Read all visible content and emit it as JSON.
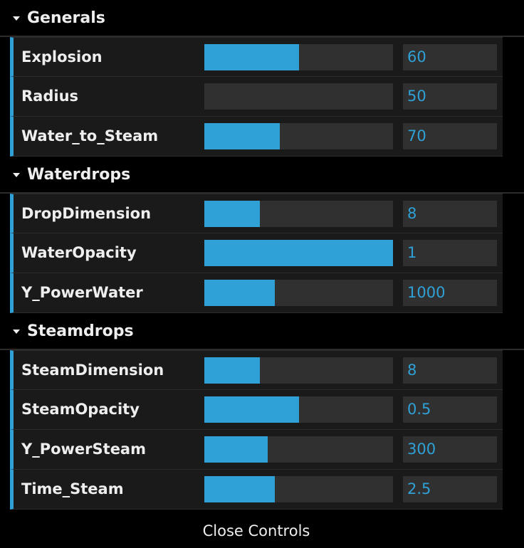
{
  "folders": [
    {
      "title": "Generals",
      "controls": [
        {
          "label": "Explosion",
          "value": "60",
          "fill_fraction": 0.5
        },
        {
          "label": "Radius",
          "value": "50",
          "fill_fraction": 0.0
        },
        {
          "label": "Water_to_Steam",
          "value": "70",
          "fill_fraction": 0.4
        }
      ]
    },
    {
      "title": "Waterdrops",
      "controls": [
        {
          "label": "DropDimension",
          "value": "8",
          "fill_fraction": 0.295
        },
        {
          "label": "WaterOpacity",
          "value": "1",
          "fill_fraction": 1.0
        },
        {
          "label": "Y_PowerWater",
          "value": "1000",
          "fill_fraction": 0.375
        }
      ]
    },
    {
      "title": "Steamdrops",
      "controls": [
        {
          "label": "SteamDimension",
          "value": "8",
          "fill_fraction": 0.295
        },
        {
          "label": "SteamOpacity",
          "value": "0.5",
          "fill_fraction": 0.5
        },
        {
          "label": "Y_PowerSteam",
          "value": "300",
          "fill_fraction": 0.335
        },
        {
          "label": "Time_Steam",
          "value": "2.5",
          "fill_fraction": 0.375
        }
      ]
    }
  ],
  "close_label": "Close Controls",
  "colors": {
    "accent": "#2fa1d6",
    "background": "#000000",
    "row_background": "#1a1a1a",
    "field_background": "#303030",
    "text": "#eeeeee"
  }
}
